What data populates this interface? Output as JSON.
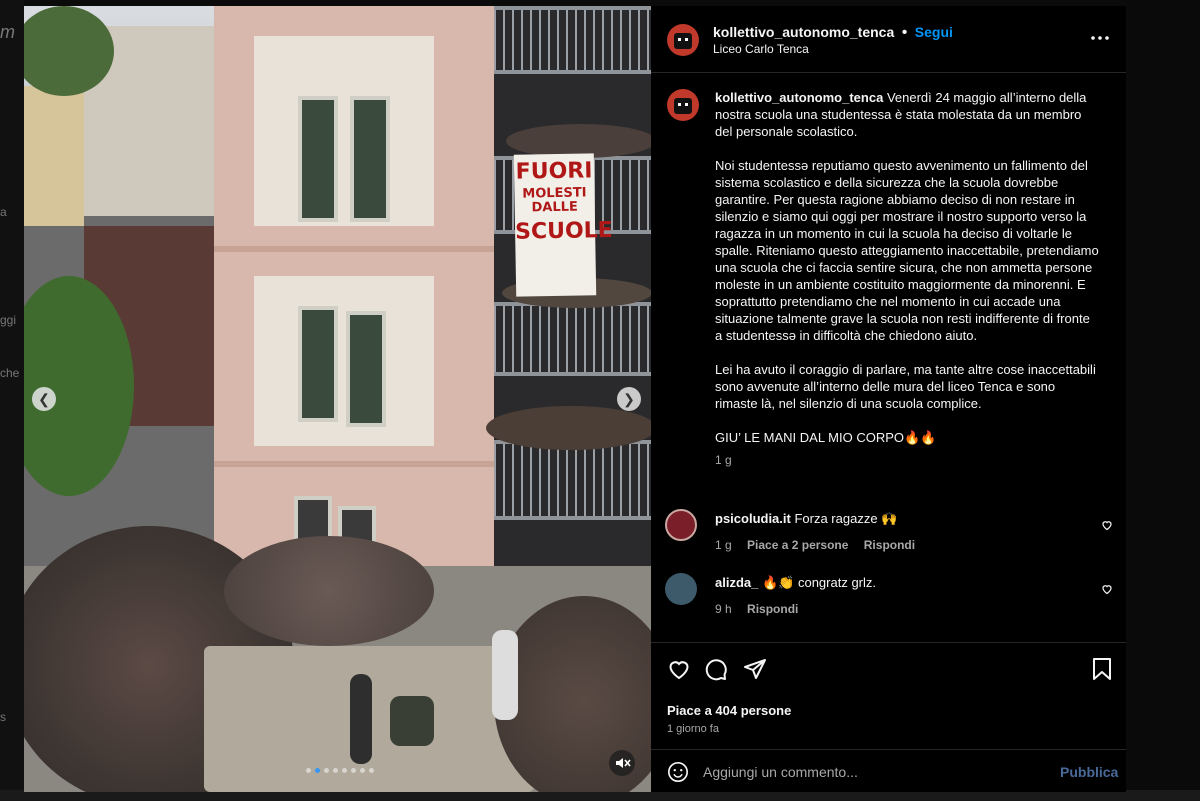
{
  "background": {
    "left_fragments": [
      "m",
      "a",
      "ggi",
      "che",
      "s"
    ]
  },
  "post": {
    "image": {
      "banner_lines": [
        "FUORI",
        "MOLESTI",
        "DALLE",
        "SCUOLE"
      ],
      "carousel_total": 8,
      "carousel_active": 1
    },
    "header": {
      "username": "kollettivo_autonomo_tenca",
      "separator": "•",
      "follow_label": "Segui",
      "location": "Liceo Carlo Tenca",
      "more_icon": "more-horizontal-icon"
    },
    "caption": {
      "username": "kollettivo_autonomo_tenca",
      "paragraphs": [
        "Venerdì 24 maggio all’interno della nostra scuola una studentessa è stata molestata da un membro del personale scolastico.",
        "Noi studentessə reputiamo questo avvenimento un fallimento del sistema scolastico e della sicurezza che la scuola dovrebbe garantire. Per questa ragione abbiamo deciso di non restare in silenzio e siamo qui oggi per mostrare il nostro supporto verso la ragazza in un momento in cui la scuola ha deciso di voltarle le spalle. Riteniamo questo atteggiamento inaccettabile, pretendiamo una scuola che ci faccia sentire sicura, che non ammetta persone moleste in un ambiente costituito maggiormente da minorenni. E soprattutto pretendiamo che nel momento in cui accade una situazione talmente grave la scuola non resti indifferente di fronte a studentessə in difficoltà che chiedono aiuto.",
        "Lei ha avuto il coraggio di parlare, ma tante altre cose inaccettabili sono avvenute all’interno delle mura del liceo Tenca e sono rimaste là, nel silenzio di una scuola complice.",
        "GIU’ LE MANI DAL MIO CORPO🔥🔥"
      ],
      "time": "1 g"
    },
    "comments": [
      {
        "username": "psicoludia.it",
        "text": "Forza ragazze 🙌",
        "time": "1 g",
        "likes": "Piace a 2 persone",
        "reply": "Rispondi"
      },
      {
        "username": "alizda_",
        "text": "🔥👏 congratz grlz.",
        "time": "9 h",
        "likes": "",
        "reply": "Rispondi"
      }
    ],
    "actions": {
      "like_icon": "heart-icon",
      "comment_icon": "comment-icon",
      "share_icon": "share-icon",
      "save_icon": "bookmark-icon"
    },
    "likes_text": "Piace a 404 persone",
    "posted": "1 giorno fa",
    "add_comment": {
      "placeholder": "Aggiungi un commento...",
      "publish_label": "Pubblica",
      "emoji_icon": "emoji-icon"
    },
    "colors": {
      "accent": "#0095f6",
      "publish_disabled": "#4a6a9a",
      "avatar": "#c0392b"
    }
  }
}
